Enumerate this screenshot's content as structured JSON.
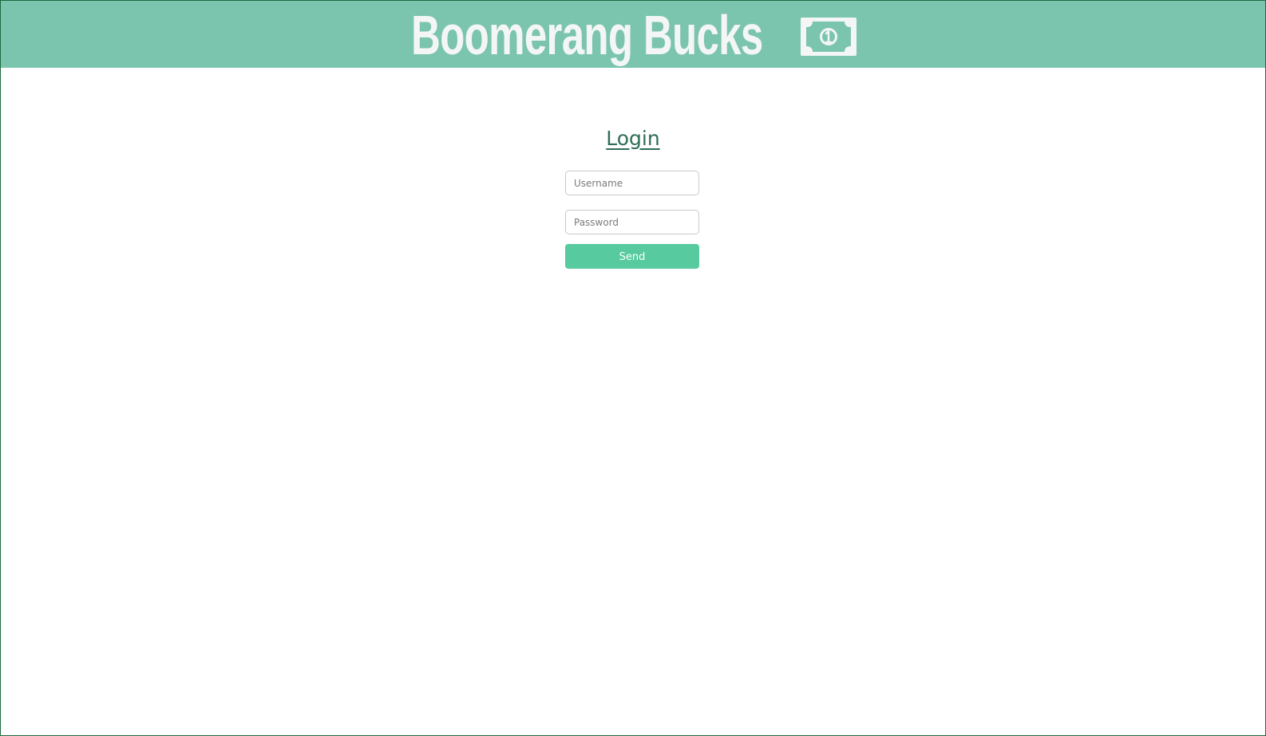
{
  "header": {
    "title": "Boomerang Bucks",
    "logo_icon": "dollar-bill-icon",
    "background": "#7bc4ae",
    "text_color": "#f3f6f5"
  },
  "login": {
    "title": "Login",
    "username": {
      "value": "",
      "placeholder": "Username"
    },
    "password": {
      "value": "",
      "placeholder": "Password"
    },
    "send_label": "Send",
    "send_color": "#57cb9f",
    "title_color": "#2e6d55"
  }
}
